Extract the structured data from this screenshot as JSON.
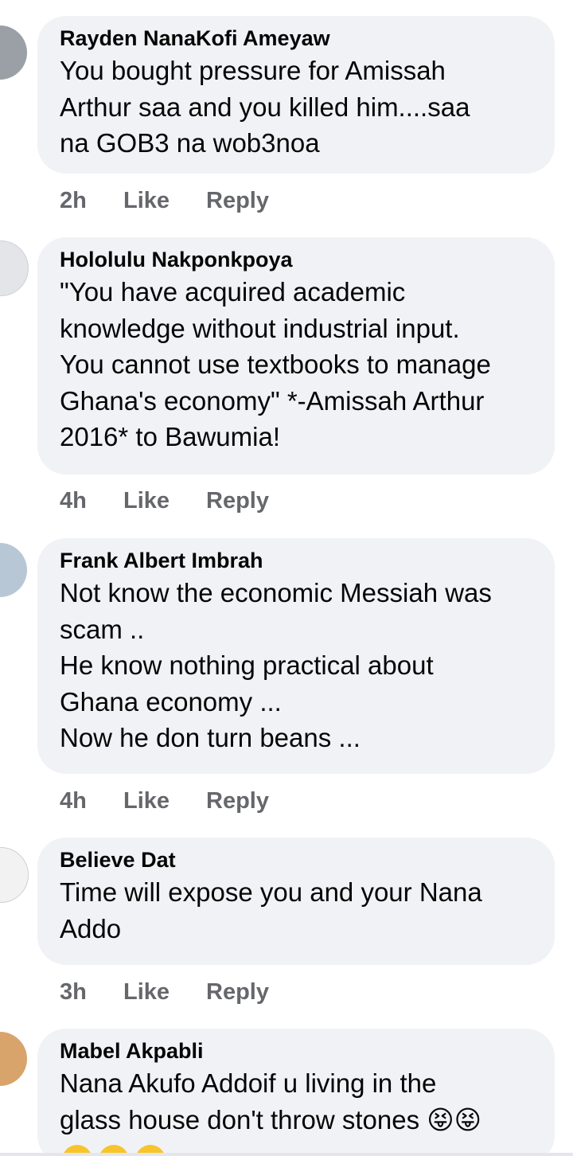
{
  "comments": [
    {
      "author": "Rayden NanaKofi Ameyaw",
      "text": "You bought pressure for Amissah\nArthur saa and you killed him....saa\nna GOB3 na wob3noa",
      "time": "2h",
      "like_label": "Like",
      "reply_label": "Reply"
    },
    {
      "author": "Hololulu Nakponkpoya",
      "text": "\"You have acquired academic\nknowledge without industrial input.\nYou cannot use textbooks to manage\nGhana's economy\" *-Amissah Arthur\n2016* to Bawumia!",
      "time": "4h",
      "like_label": "Like",
      "reply_label": "Reply"
    },
    {
      "author": "Frank Albert Imbrah",
      "text": "Not know the economic Messiah was\nscam ..\nHe know nothing practical about\nGhana economy ...\nNow he don turn beans ...",
      "time": "4h",
      "like_label": "Like",
      "reply_label": "Reply"
    },
    {
      "author": "Believe Dat",
      "text": "Time will expose you and your Nana\nAddo",
      "time": "3h",
      "like_label": "Like",
      "reply_label": "Reply"
    },
    {
      "author": "Mabel Akpabli",
      "text": "Nana Akufo Addoif u living in the\nglass house don't throw stones 😝😝",
      "time": "",
      "like_label": "",
      "reply_label": ""
    }
  ],
  "colors": {
    "bubble": "#f0f2f5",
    "text": "#050505",
    "meta": "#65676b"
  }
}
